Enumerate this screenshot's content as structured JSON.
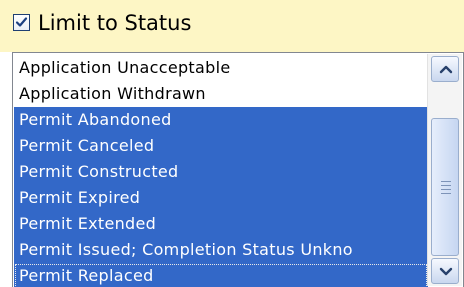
{
  "header": {
    "checkbox_checked": true,
    "label": "Limit to Status"
  },
  "listbox": {
    "items": [
      {
        "label": "Application Unacceptable",
        "selected": false
      },
      {
        "label": "Application Withdrawn",
        "selected": false
      },
      {
        "label": "Permit Abandoned",
        "selected": true
      },
      {
        "label": "Permit Canceled",
        "selected": true
      },
      {
        "label": "Permit Constructed",
        "selected": true
      },
      {
        "label": "Permit Expired",
        "selected": true
      },
      {
        "label": "Permit Extended",
        "selected": true
      },
      {
        "label": "Permit Issued; Completion Status Unkno",
        "selected": true
      },
      {
        "label": "Permit Replaced",
        "selected": true
      }
    ]
  },
  "icons": {
    "checkbox": "checkmark-icon",
    "scroll_up": "chevron-up-icon",
    "scroll_down": "chevron-down-icon"
  },
  "colors": {
    "header_background": "#fdf6c5",
    "selection": "#3368c8"
  }
}
